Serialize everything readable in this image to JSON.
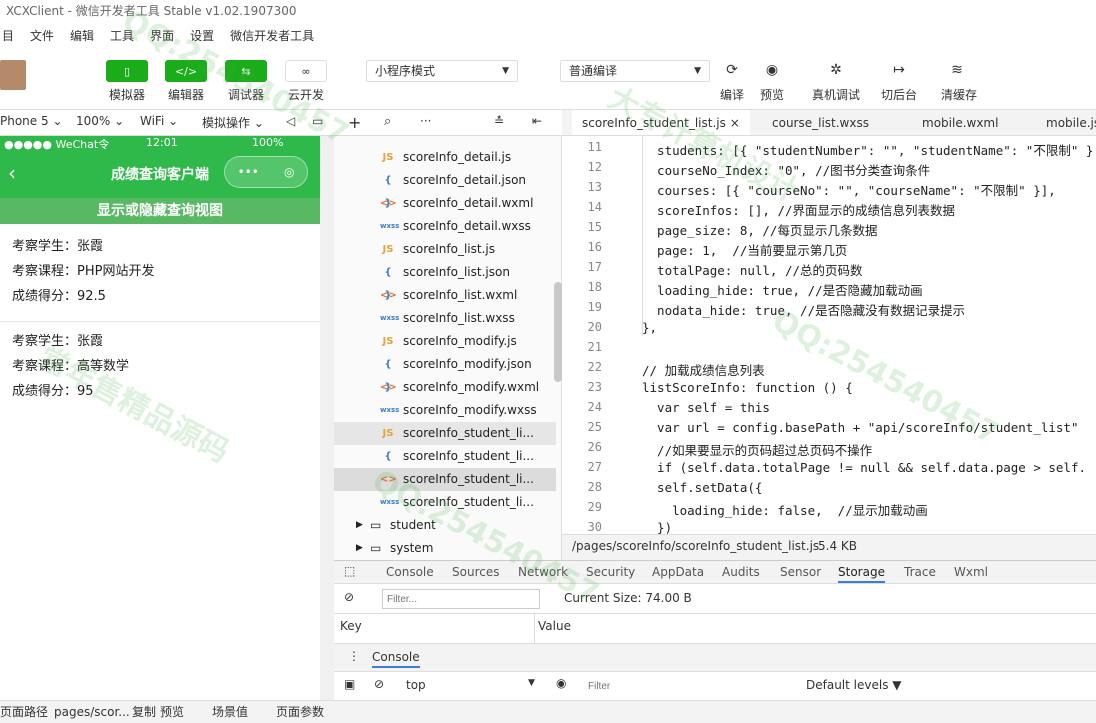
{
  "window": {
    "title": "XCXClient - 微信开发者工具 Stable v1.02.1907300"
  },
  "menu": [
    "目",
    "文件",
    "编辑",
    "工具",
    "界面",
    "设置",
    "微信开发者工具"
  ],
  "toolbar": {
    "simulator": "模拟器",
    "editor": "编辑器",
    "debugger": "调试器",
    "cloud": "云开发",
    "mode_select": "小程序模式",
    "compile_select": "普通编译",
    "compile": "编译",
    "preview": "预览",
    "real_debug": "真机调试",
    "switch_bg": "切后台",
    "clear_cache": "清缓存"
  },
  "simbar": {
    "device": "Phone 5",
    "zoom": "100%",
    "network": "WiFi",
    "ops": "模拟操作"
  },
  "phone": {
    "status_left": "●●●●● WeChat令",
    "status_time": "12:01",
    "status_right": "100%",
    "nav_title": "成绩查询客户端",
    "toggle": "显示或隐藏查询视图",
    "records": [
      {
        "student": "考察学生：张霞",
        "course": "考察课程：PHP网站开发",
        "score": "成绩得分：92.5"
      },
      {
        "student": "考察学生：张霞",
        "course": "考察课程：高等数学",
        "score": "成绩得分：95"
      }
    ]
  },
  "tree": {
    "files": [
      {
        "icon": "JS",
        "name": "scoreInfo_detail.js"
      },
      {
        "icon": "{ }",
        "name": "scoreInfo_detail.json"
      },
      {
        "icon": "<>",
        "name": "scoreInfo_detail.wxml"
      },
      {
        "icon": "wxss",
        "name": "scoreInfo_detail.wxss"
      },
      {
        "icon": "JS",
        "name": "scoreInfo_list.js"
      },
      {
        "icon": "{ }",
        "name": "scoreInfo_list.json"
      },
      {
        "icon": "<>",
        "name": "scoreInfo_list.wxml"
      },
      {
        "icon": "wxss",
        "name": "scoreInfo_list.wxss"
      },
      {
        "icon": "JS",
        "name": "scoreInfo_modify.js"
      },
      {
        "icon": "{ }",
        "name": "scoreInfo_modify.json"
      },
      {
        "icon": "<>",
        "name": "scoreInfo_modify.wxml"
      },
      {
        "icon": "wxss",
        "name": "scoreInfo_modify.wxss"
      },
      {
        "icon": "JS",
        "name": "scoreInfo_student_li..."
      },
      {
        "icon": "{ }",
        "name": "scoreInfo_student_li..."
      },
      {
        "icon": "<>",
        "name": "scoreInfo_student_li..."
      },
      {
        "icon": "wxss",
        "name": "scoreInfo_student_li..."
      }
    ],
    "folders": [
      "student",
      "system"
    ]
  },
  "tabs": [
    "scoreInfo_student_list.js",
    "course_list.wxss",
    "mobile.wxml",
    "mobile.js"
  ],
  "code": [
    {
      "n": "11",
      "t": "  students: [{ \"studentNumber\": \"\", \"studentName\": \"不限制\" }"
    },
    {
      "n": "12",
      "t": "  courseNo_Index: \"0\", //图书分类查询条件"
    },
    {
      "n": "13",
      "t": "  courses: [{ \"courseNo\": \"\", \"courseName\": \"不限制\" }],"
    },
    {
      "n": "14",
      "t": "  scoreInfos: [], //界面显示的成绩信息列表数据"
    },
    {
      "n": "15",
      "t": "  page_size: 8, //每页显示几条数据"
    },
    {
      "n": "16",
      "t": "  page: 1,  //当前要显示第几页"
    },
    {
      "n": "17",
      "t": "  totalPage: null, //总的页码数"
    },
    {
      "n": "18",
      "t": "  loading_hide: true, //是否隐藏加载动画"
    },
    {
      "n": "19",
      "t": "  nodata_hide: true, //是否隐藏没有数据记录提示"
    },
    {
      "n": "20",
      "t": "},"
    },
    {
      "n": "21",
      "t": ""
    },
    {
      "n": "22",
      "t": "// 加载成绩信息列表"
    },
    {
      "n": "23",
      "t": "listScoreInfo: function () {"
    },
    {
      "n": "24",
      "t": "  var self = this"
    },
    {
      "n": "25",
      "t": "  var url = config.basePath + \"api/scoreInfo/student_list\""
    },
    {
      "n": "26",
      "t": "  //如果要显示的页码超过总页码不操作"
    },
    {
      "n": "27",
      "t": "  if (self.data.totalPage != null && self.data.page > self."
    },
    {
      "n": "28",
      "t": "  self.setData({"
    },
    {
      "n": "29",
      "t": "    loading_hide: false,  //显示加载动画"
    },
    {
      "n": "30",
      "t": "  })"
    }
  ],
  "editor_status": {
    "path": "/pages/scoreInfo/scoreInfo_student_list.js",
    "size": "5.4 KB"
  },
  "devtools": {
    "tabs": [
      "Console",
      "Sources",
      "Network",
      "Security",
      "AppData",
      "Audits",
      "Sensor",
      "Storage",
      "Trace",
      "Wxml"
    ],
    "filter_placeholder": "Filter...",
    "current_size": "Current Size:  74.00 B",
    "col_key": "Key",
    "col_value": "Value",
    "console_tab": "Console",
    "context": "top",
    "filter2": "Filter",
    "levels": "Default levels ▼"
  },
  "statusbar": {
    "path_label": "页面路径",
    "path": "pages/scor...",
    "copy": "复制",
    "preview": "预览",
    "scene": "场景值",
    "params": "页面参数"
  },
  "watermarks": [
    "QQ:254540457",
    "常年售精品源码",
    "大专计算机设计"
  ]
}
